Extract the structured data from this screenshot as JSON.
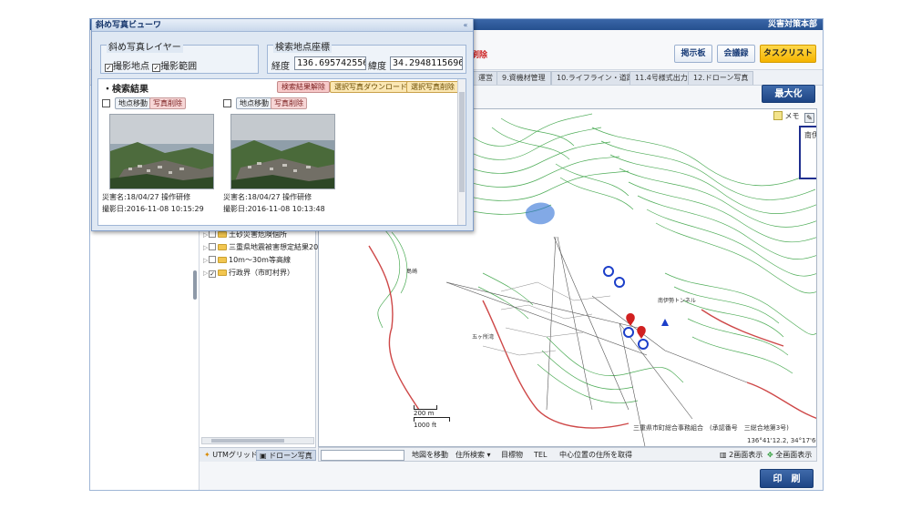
{
  "header": {
    "hq_title": "災害対策本部",
    "red_action": "刷除",
    "buttons": {
      "bulletin": "掲示板",
      "liaison": "会議録",
      "task_list": "タスクリスト"
    }
  },
  "tabs": [
    {
      "label": "運営"
    },
    {
      "label": "9.資機材管理"
    },
    {
      "label": "10.ライフライン・道路"
    },
    {
      "label": "11.4号様式出力"
    },
    {
      "label": "12.ドローン写真"
    }
  ],
  "maximize_label": "最大化",
  "print_label": "印　刷",
  "photo_viewer": {
    "title": "斜め写真ビューワ",
    "collapse_glyph": "«",
    "layer_legend": "斜め写真レイヤー",
    "layer_checks": [
      {
        "label": "撮影地点",
        "checked": true
      },
      {
        "label": "撮影範囲",
        "checked": true
      }
    ],
    "coord_legend": "検索地点座標",
    "longitude_label": "経度",
    "longitude_value": "136.69574255670",
    "latitude_label": "緯度",
    "latitude_value": "34.2948115696317",
    "results_title": "・検索結果",
    "result_buttons": {
      "clear": "検索結果解除",
      "download": "選択写真ダウンロード",
      "delete": "選択写真削除"
    },
    "cards": [
      {
        "move": "地点移動",
        "delete": "写真削除",
        "caption": "災害名:18/04/27 操作研修",
        "date": "撮影日:2016-11-08 10:15:29"
      },
      {
        "move": "地点移動",
        "delete": "写真削除",
        "caption": "災害名:18/04/27 操作研修",
        "date": "撮影日:2016-11-08 10:13:48"
      }
    ]
  },
  "layers": [
    {
      "label": "土砂災害危険個所",
      "checked": false
    },
    {
      "label": "三重県地震被害想定結果2014",
      "checked": false
    },
    {
      "label": "10m～30m等高線",
      "checked": false
    },
    {
      "label": "行政界（市町村界）",
      "checked": true
    }
  ],
  "layer_bottom_tabs": {
    "utm": "UTMグリッド",
    "drone": "ドローン写真"
  },
  "map": {
    "memo_label": "メモ",
    "overview_label": "南伊勢町",
    "place_labels": {
      "bay": "五ヶ所湾",
      "island": "島崎",
      "tunnel": "南伊勢トンネル"
    },
    "scale_m": "200 m",
    "scale_ft": "1000 ft",
    "credit": "三重県市町総合事務組合　(承認番号　三総合地第3号)",
    "coordinate": "136°41'12.2, 34°17'60.0",
    "accent_green": "#2f9e3a",
    "marker_blue": "#1c3fc9",
    "marker_red": "#d12020"
  },
  "map_bottom": {
    "search_placeholder": "",
    "goto": "地図を移動",
    "address_search": "住所検索",
    "landmark": "目標物",
    "tel": "TEL",
    "center_address": "中心位置の住所を取得",
    "two_screen": "2画面表示",
    "full_screen": "全画面表示"
  }
}
